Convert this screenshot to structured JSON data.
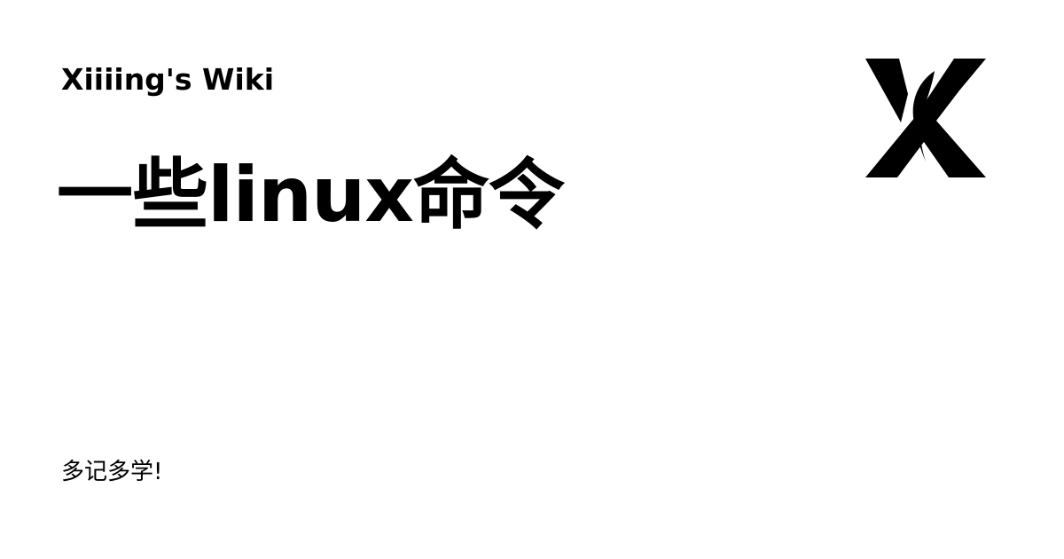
{
  "site": {
    "name": "Xiiiing's Wiki"
  },
  "page": {
    "title": "一些linux命令",
    "tagline": "多记多学!"
  },
  "logo": {
    "icon": "x-logo-icon",
    "color": "#000000"
  },
  "theme": {
    "background": "#ffffff",
    "text": "#000000"
  }
}
